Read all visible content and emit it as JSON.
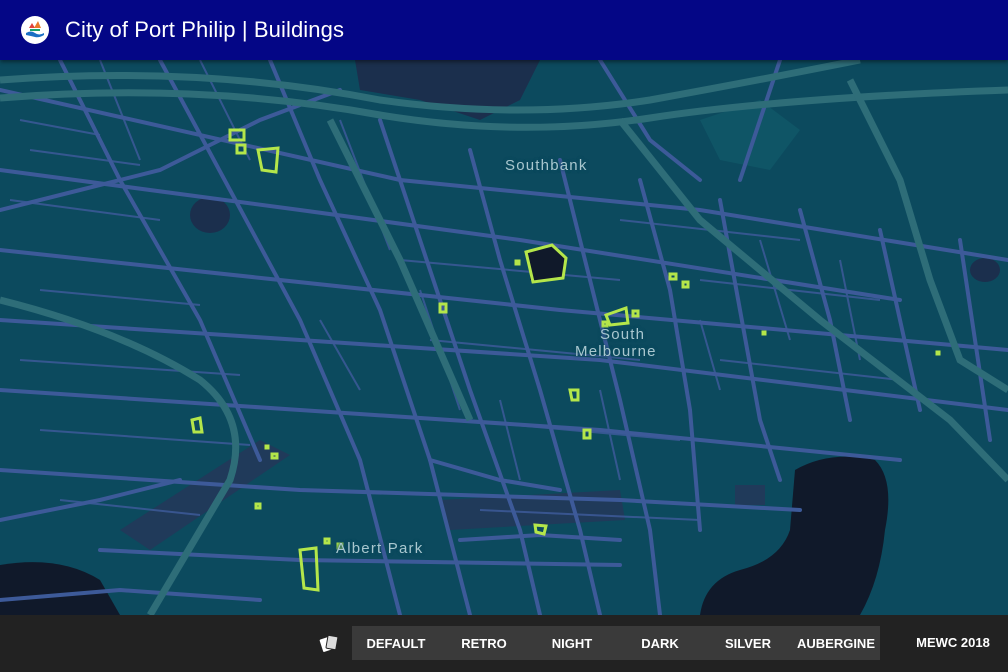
{
  "header": {
    "title": "City of Port Philip | Buildings",
    "logo_icon": "city-logo-icon"
  },
  "map": {
    "labels": {
      "southbank": "Southbank",
      "south_melbourne_line1": "South",
      "south_melbourne_line2": "Melbourne",
      "albert_park": "Albert Park"
    },
    "colors": {
      "background": "#0c4a5e",
      "roads": "#3d5a99",
      "highways": "#2e6d78",
      "water": "#10192a",
      "parks": "#203a5a",
      "buildings": "#b4e64a"
    }
  },
  "footer": {
    "style_icon": "map-style-cards-icon",
    "styles": [
      "DEFAULT",
      "RETRO",
      "NIGHT",
      "DARK",
      "SILVER",
      "AUBERGINE"
    ],
    "credit": "MEWC 2018"
  }
}
